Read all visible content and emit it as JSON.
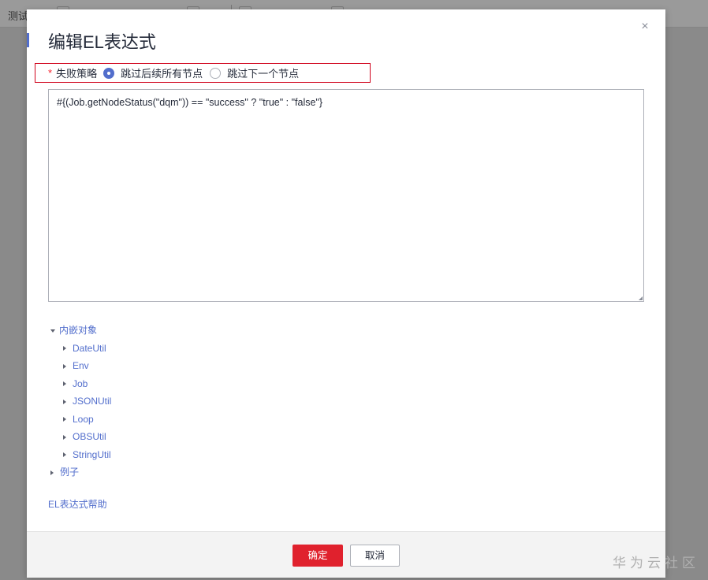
{
  "background": {
    "tab_label": "测试"
  },
  "dialog": {
    "title": "编辑EL表达式",
    "close_glyph": "×",
    "failure_strategy": {
      "required_mark": "*",
      "label": "失败策略",
      "options": [
        {
          "label": "跳过后续所有节点",
          "checked": true
        },
        {
          "label": "跳过下一个节点",
          "checked": false
        }
      ]
    },
    "expression_value": "#{(Job.getNodeStatus(\"dqm\")) == \"success\" ? \"true\" : \"false\"}",
    "tree": {
      "root_label": "内嵌对象",
      "root_expanded": true,
      "children": [
        "DateUtil",
        "Env",
        "Job",
        "JSONUtil",
        "Loop",
        "OBSUtil",
        "StringUtil"
      ],
      "examples_label": "例子"
    },
    "help_link": "EL表达式帮助",
    "confirm_label": "确定",
    "cancel_label": "取消"
  },
  "watermark": "华为云社区",
  "colors": {
    "primary_button": "#e0212d",
    "link": "#526ecc",
    "highlight_border": "#d0021b"
  }
}
